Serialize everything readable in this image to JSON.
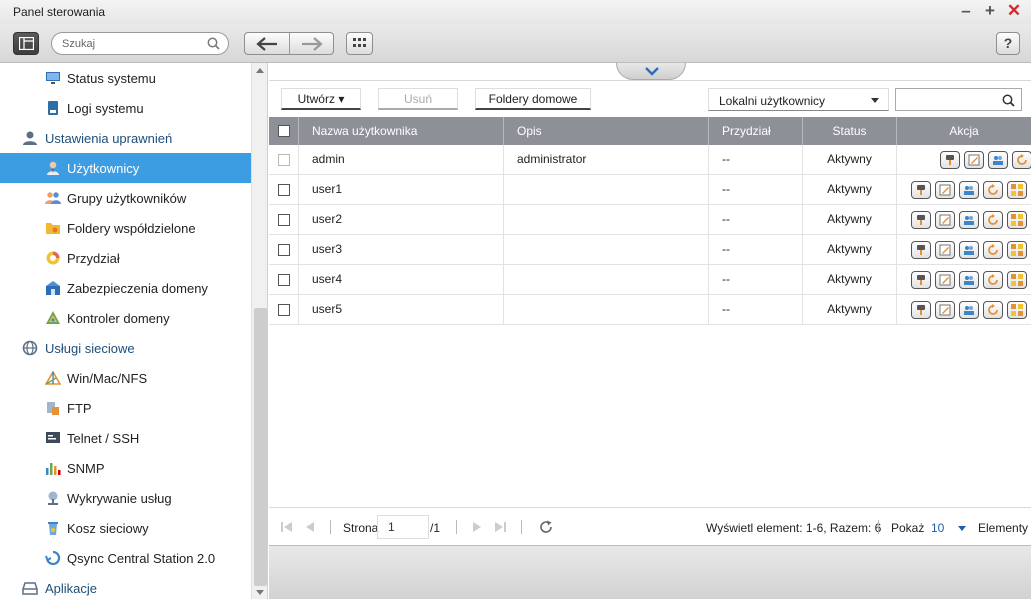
{
  "window": {
    "title": "Panel sterowania"
  },
  "toolbar": {
    "search_placeholder": "Szukaj",
    "help_label": "?"
  },
  "sidebar": {
    "items": [
      {
        "label": "Status systemu",
        "type": "child",
        "icon": "monitor-icon"
      },
      {
        "label": "Logi systemu",
        "type": "child",
        "icon": "log-icon"
      },
      {
        "label": "Ustawienia uprawnień",
        "type": "category",
        "icon": "user-category-icon"
      },
      {
        "label": "Użytkownicy",
        "type": "child",
        "icon": "user-icon",
        "active": true
      },
      {
        "label": "Grupy użytkowników",
        "type": "child",
        "icon": "group-icon"
      },
      {
        "label": "Foldery współdzielone",
        "type": "child",
        "icon": "folder-icon"
      },
      {
        "label": "Przydział",
        "type": "child",
        "icon": "quota-icon"
      },
      {
        "label": "Zabezpieczenia domeny",
        "type": "child",
        "icon": "domain-security-icon"
      },
      {
        "label": "Kontroler domeny",
        "type": "child",
        "icon": "domain-controller-icon"
      },
      {
        "label": "Usługi sieciowe",
        "type": "category",
        "icon": "network-category-icon"
      },
      {
        "label": "Win/Mac/NFS",
        "type": "child",
        "icon": "winmacnfs-icon"
      },
      {
        "label": "FTP",
        "type": "child",
        "icon": "ftp-icon"
      },
      {
        "label": "Telnet / SSH",
        "type": "child",
        "icon": "terminal-icon"
      },
      {
        "label": "SNMP",
        "type": "child",
        "icon": "snmp-icon"
      },
      {
        "label": "Wykrywanie usług",
        "type": "child",
        "icon": "service-discovery-icon"
      },
      {
        "label": "Kosz sieciowy",
        "type": "child",
        "icon": "recycle-bin-icon"
      },
      {
        "label": "Qsync Central Station 2.0",
        "type": "child",
        "icon": "qsync-icon"
      },
      {
        "label": "Aplikacje",
        "type": "category",
        "icon": "applications-category-icon"
      }
    ]
  },
  "actions": {
    "create_label": "Utwórz",
    "delete_label": "Usuń",
    "home_folders_label": "Foldery domowe",
    "filter_value": "Lokalni użytkownicy"
  },
  "table": {
    "headers": {
      "username": "Nazwa użytkownika",
      "description": "Opis",
      "quota": "Przydział",
      "status": "Status",
      "action": "Akcja"
    },
    "rows": [
      {
        "username": "admin",
        "description": "administrator",
        "quota": "--",
        "status": "Aktywny"
      },
      {
        "username": "user1",
        "description": "",
        "quota": "--",
        "status": "Aktywny"
      },
      {
        "username": "user2",
        "description": "",
        "quota": "--",
        "status": "Aktywny"
      },
      {
        "username": "user3",
        "description": "",
        "quota": "--",
        "status": "Aktywny"
      },
      {
        "username": "user4",
        "description": "",
        "quota": "--",
        "status": "Aktywny"
      },
      {
        "username": "user5",
        "description": "",
        "quota": "--",
        "status": "Aktywny"
      }
    ]
  },
  "pager": {
    "page_label": "Strona",
    "page_value": "1",
    "page_total": "/1",
    "display_info": "Wyświetl element: 1-6, Razem: 6",
    "show_label": "Pokaż",
    "page_size": "10",
    "items_label": "Elementy"
  },
  "colors": {
    "accent": "#3d9de3",
    "header_bg": "#8e9098",
    "close": "#d9262c"
  }
}
